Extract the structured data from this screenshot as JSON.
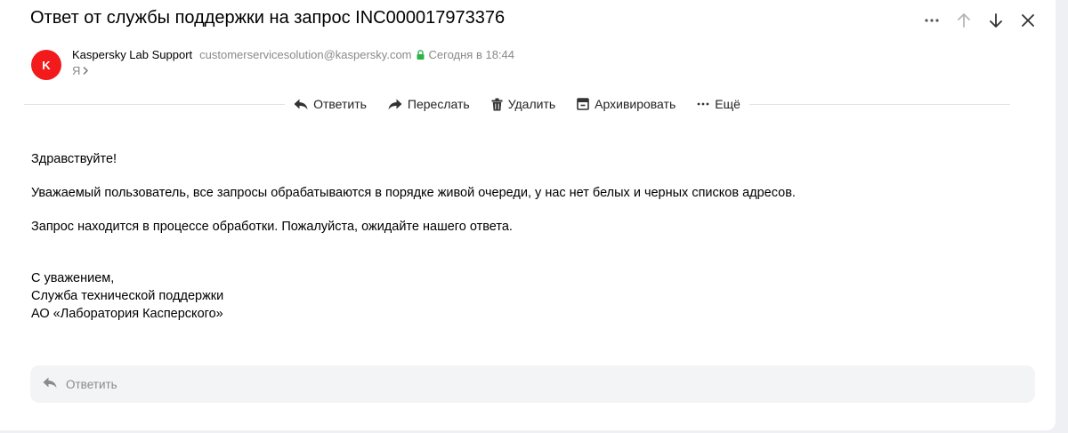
{
  "message": {
    "subject": "Ответ от службы поддержки на запрос INC000017973376",
    "sender": {
      "avatar_letter": "K",
      "avatar_color": "#f21a1a",
      "name": "Kaspersky Lab Support",
      "email": "customerservicesolution@kaspersky.com",
      "date": "Сегодня в 18:44",
      "lock_color": "#2bb34a"
    },
    "recipient": {
      "label": "Я"
    },
    "body": {
      "greeting": "Здравствуйте!",
      "paragraph1": "Уважаемый пользователь, все запросы обрабатываются в порядке живой очереди, у нас нет белых и черных списков адресов.",
      "paragraph2": "Запрос находится в процессе обработки. Пожалуйста, ожидайте нашего ответа.",
      "signature_line1": "С уважением,",
      "signature_line2": "Служба технической поддержки",
      "signature_line3": "АО «Лаборатория Касперского»"
    }
  },
  "toolbar": {
    "reply_label": "Ответить",
    "forward_label": "Переслать",
    "delete_label": "Удалить",
    "archive_label": "Архивировать",
    "more_label": "Ещё"
  },
  "top_actions": {
    "more_icon": "more-horizontal-icon",
    "prev_icon": "arrow-up-icon",
    "next_icon": "arrow-down-icon",
    "close_icon": "close-icon"
  },
  "quick_reply": {
    "label": "Ответить"
  }
}
